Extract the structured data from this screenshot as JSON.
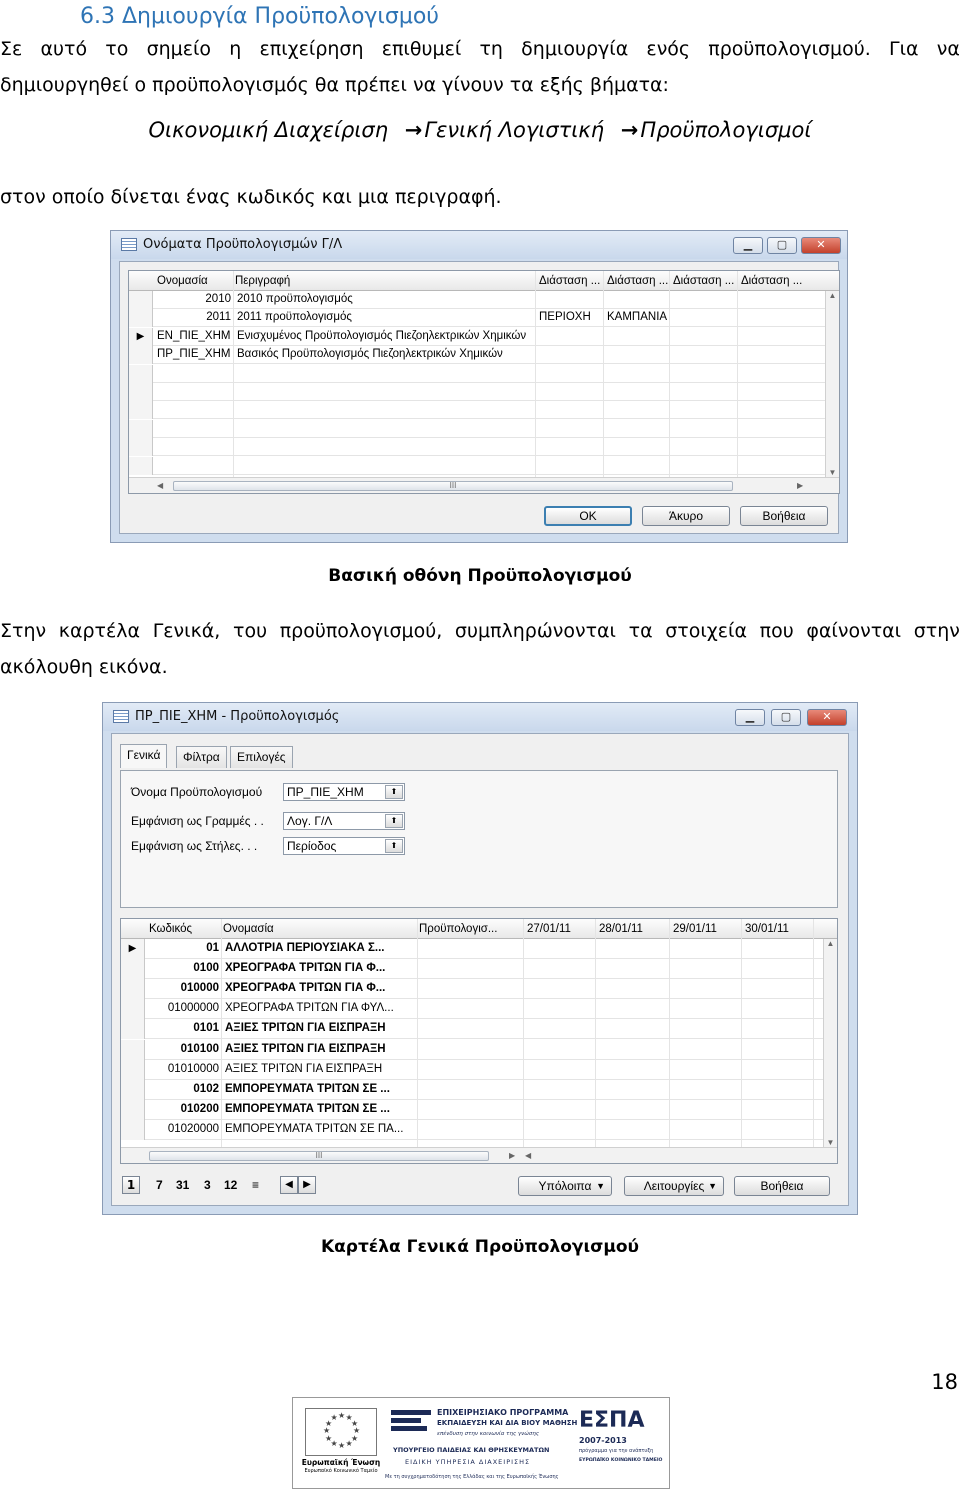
{
  "section": {
    "heading": "6.3 Δημιουργία Προϋπολογισμού",
    "intro_line1_words": [
      "Σε",
      "αυτό",
      "το",
      "σημείο",
      "η",
      "επιχείρηση",
      "επιθυμεί",
      "τη",
      "δημιουργία",
      "ενός",
      "προϋπολογισμού.",
      "Για",
      "να"
    ],
    "intro_line2": "δημιουργηθεί ο προϋπολογισμός θα πρέπει να γίνουν τα εξής βήματα:",
    "path": [
      "Οικονομική Διαχείριση",
      "Γενική Λογιστική",
      "Προϋπολογισμοί"
    ],
    "path_arrow": "→",
    "after_path": "στον οποίο δίνεται ένας κωδικός και μια περιγραφή.",
    "caption1": "Βασική οθόνη Προϋπολογισμού",
    "para2_line1_words": [
      "Στην",
      "καρτέλα",
      "Γενικά,",
      "του",
      "προϋπολογισμού,",
      "συμπληρώνονται",
      "τα",
      "στοιχεία",
      "που",
      "φαίνονται",
      "στην"
    ],
    "para2_line2": "ακόλουθη εικόνα.",
    "caption2": "Καρτέλα Γενικά Προϋπολογισμού",
    "page_number": "18"
  },
  "window1": {
    "title": "Ονόματα Προϋπολογισμών Γ/Λ",
    "columns": [
      "Ονομασία",
      "Περιγραφή",
      "Διάσταση ...",
      "Διάσταση ...",
      "Διάσταση ...",
      "Διάσταση ..."
    ],
    "rows": [
      {
        "name": "2010",
        "desc": "2010 προϋπολογισμός",
        "dim1": "",
        "dim2": "",
        "marker": ""
      },
      {
        "name": "2011",
        "desc": "2011 προϋπολογισμός",
        "dim1": "ΠΕΡΙΟΧΗ",
        "dim2": "ΚΑΜΠΑΝΙΑ",
        "marker": ""
      },
      {
        "name": "ΕΝ_ΠΙΕ_ΧΗΜ",
        "desc": "Ενισχυμένος Προϋπολογισμός Πιεζοηλεκτρικών Χημικών",
        "dim1": "",
        "dim2": "",
        "marker": "▶"
      },
      {
        "name": "ΠΡ_ΠΙΕ_ΧΗΜ",
        "desc": "Βασικός Προϋπολογισμός Πιεζοηλεκτρικών Χημικών",
        "dim1": "",
        "dim2": "",
        "marker": ""
      }
    ],
    "buttons": {
      "ok": "OK",
      "cancel": "Άκυρο",
      "help": "Βοήθεια"
    },
    "scroll_mark": "III"
  },
  "window2": {
    "title": "ΠΡ_ΠΙΕ_ΧΗΜ - Προϋπολογισμός",
    "tabs": [
      "Γενικά",
      "Φίλτρα",
      "Επιλογές"
    ],
    "fields": [
      {
        "label": "Όνομα Προϋπολογισμού",
        "value": "ΠΡ_ΠΙΕ_ΧΗΜ"
      },
      {
        "label": "Εμφάνιση ως Γραμμές . .",
        "value": "Λογ. Γ/Λ"
      },
      {
        "label": "Εμφάνιση ως Στήλες. . .",
        "value": "Περίοδος"
      }
    ],
    "columns": [
      "Κωδικός",
      "Ονομασία",
      "Προϋπολογισ...",
      "27/01/11",
      "28/01/11",
      "29/01/11",
      "30/01/11"
    ],
    "rows": [
      {
        "code": "01",
        "name": "ΑΛΛΟΤΡΙΑ ΠΕΡΙΟΥΣΙΑΚΑ Σ...",
        "bold": true,
        "marker": "▶"
      },
      {
        "code": "0100",
        "name": "ΧΡΕΟΓΡΑΦΑ ΤΡΙΤΩΝ ΓΙΑ Φ...",
        "bold": true,
        "marker": ""
      },
      {
        "code": "010000",
        "name": "ΧΡΕΟΓΡΑΦΑ ΤΡΙΤΩΝ ΓΙΑ Φ...",
        "bold": true,
        "marker": ""
      },
      {
        "code": "01000000",
        "name": "ΧΡΕΟΓΡΑΦΑ ΤΡΙΤΩΝ ΓΙΑ ΦΥΛ...",
        "bold": false,
        "marker": ""
      },
      {
        "code": "0101",
        "name": "ΑΞΙΕΣ ΤΡΙΤΩΝ ΓΙΑ ΕΙΣΠΡΑΞΗ",
        "bold": true,
        "marker": ""
      },
      {
        "code": "010100",
        "name": "ΑΞΙΕΣ ΤΡΙΤΩΝ ΓΙΑ ΕΙΣΠΡΑΞΗ",
        "bold": true,
        "marker": ""
      },
      {
        "code": "01010000",
        "name": "ΑΞΙΕΣ ΤΡΙΤΩΝ ΓΙΑ ΕΙΣΠΡΑΞΗ",
        "bold": false,
        "marker": ""
      },
      {
        "code": "0102",
        "name": "ΕΜΠΟΡΕΥΜΑΤΑ ΤΡΙΤΩΝ ΣΕ ...",
        "bold": true,
        "marker": ""
      },
      {
        "code": "010200",
        "name": "ΕΜΠΟΡΕΥΜΑΤΑ ΤΡΙΤΩΝ ΣΕ ...",
        "bold": true,
        "marker": ""
      },
      {
        "code": "01020000",
        "name": "ΕΜΠΟΡΕΥΜΑΤΑ ΤΡΙΤΩΝ ΣΕ ΠΑ...",
        "bold": false,
        "marker": ""
      }
    ],
    "nav_items": [
      "1",
      "7",
      "31",
      "3",
      "12",
      "≡"
    ],
    "nav_arrows": [
      "◀",
      "▶"
    ],
    "buttons": {
      "balances": "Υπόλοιπα",
      "functions": "Λειτουργίες",
      "help": "Βοήθεια"
    },
    "dropdown_mark": "▼",
    "scroll_mark": "III"
  },
  "footer": {
    "eu_label": "Ευρωπαϊκή Ένωση",
    "eu_sub": "Ευρωπαϊκό Κοινωνικό Ταμείο",
    "prog_line1": "ΕΠΙΧΕΙΡΗΣΙΑΚΟ ΠΡΟΓΡΑΜΜΑ",
    "prog_line2": "ΕΚΠΑΙΔΕΥΣΗ ΚΑΙ ΔΙΑ ΒΙΟΥ ΜΑΘΗΣΗ",
    "prog_line3": "επένδυση στην κοινωνία της γνώσης",
    "ministry": "ΥΠΟΥΡΓΕΙΟ ΠΑΙΔΕΙΑΣ ΚΑΙ ΘΡΗΣΚΕΥΜΑΤΩΝ",
    "authority": "ΕΙΔΙΚΗ ΥΠΗΡΕΣΙΑ ΔΙΑΧΕΙΡΙΣΗΣ",
    "cofund": "Με τη συγχρηματοδότηση της Ελλάδας και της Ευρωπαϊκής Ένωσης",
    "espa": "ΕΣΠΑ",
    "espa_years": "2007-2013",
    "espa_sub": "πρόγραμμα για την ανάπτυξη",
    "espa_fund": "ΕΥΡΩΠΑΪΚΟ ΚΟΙΝΩΝΙΚΟ ΤΑΜΕΙΟ"
  }
}
